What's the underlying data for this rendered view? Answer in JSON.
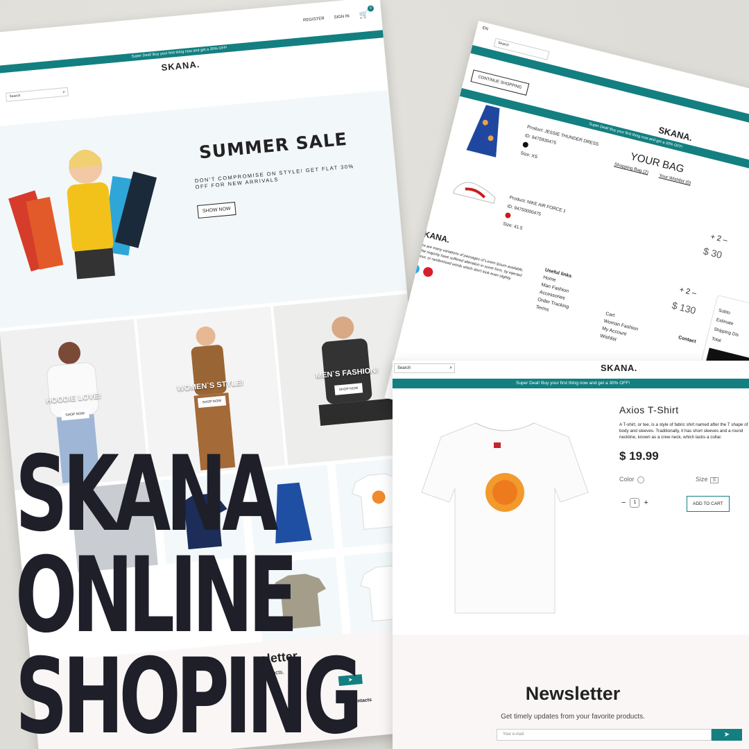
{
  "landing": {
    "nav": {
      "register": "REGISTER",
      "signin": "SIGN IN",
      "cart_count": "0"
    },
    "promo": "Super Deal! Buy your first thing now and get a 30% OFF!",
    "brand": "SKANA.",
    "search_placeholder": "Search",
    "hero": {
      "title": "SUMMER SALE",
      "subtitle": "DON'T COMPROMISE ON STYLE! GET FLAT 30% OFF FOR NEW ARRIVALS",
      "button": "SHOW NOW"
    },
    "categories": [
      {
        "label": "HOODIE LOVE!",
        "button": "SHOP NOW"
      },
      {
        "label": "WOMEN`S STYLE!",
        "button": "SHOP NOW"
      },
      {
        "label": "MEN`S FASHION!",
        "button": "SHOP NOW"
      }
    ],
    "newsletter": {
      "title": "sletter",
      "subtitle": "products."
    },
    "contacts": {
      "title": "Contacts"
    }
  },
  "cart_page": {
    "lang": "EN",
    "search_placeholder": "Search",
    "continue": "CONTINUE SHOPPING",
    "brand": "SKANA.",
    "promo": "Super Deal! Buy your first thing now and get a 30% OFF!",
    "bag_title": "YOUR BAG",
    "tabs": [
      "Shopping Bag (2)",
      "Your Wishlist (0)"
    ],
    "items": [
      {
        "product": "Product: JESSIE THUNDER DRESS",
        "id": "ID: 9475930475",
        "size": "Size: XS",
        "qty": "+ 2 –",
        "price": "$ 30",
        "dot": "#111111"
      },
      {
        "product": "Product: NIKE AIR FORCE 1",
        "id": "ID: 94750000475",
        "size": "Size: 41.5",
        "qty": "+ 2 –",
        "price": "$ 130",
        "dot": "#d01818"
      }
    ],
    "footer": {
      "brand": "SKANA.",
      "blurb": "There are many variations of passages of Lorem Ipsum available, but the majority have suffered alteration in some form, by injected humour, or randomised words which don't look even slightly",
      "links_title": "Useful links",
      "links_a": [
        "Home",
        "Man Fashion",
        "Accessories",
        "Order Tracking",
        "Terms"
      ],
      "links_b": [
        "Cart",
        "Woman Fashion",
        "My Account",
        "Wishlist"
      ],
      "contact": "Contact"
    },
    "summary": [
      "Subto",
      "Estimate",
      "Shipping Dis",
      "Total"
    ]
  },
  "product_page": {
    "search_placeholder": "Search",
    "brand": "SKANA.",
    "promo": "Super Deal! Buy your first thing now and get a 30% OFF!",
    "title": "Axios T-Shirt",
    "description": "A T-shirt, or tee, is a style of fabric shirt named after the T shape of its body and sleeves. Traditionally, it has short sleeves and a round neckline, known as a crew neck, which lacks a collar.",
    "price": "$ 19.99",
    "color_label": "Color",
    "size_label": "Size",
    "size_value": "S",
    "qty": "1",
    "add_to_cart": "ADD TO CART",
    "newsletter": {
      "title": "Newsletter",
      "subtitle": "Get timely updates from your favorite products.",
      "placeholder": "Your e-mail",
      "send": "➤"
    }
  },
  "headline": [
    "SKANA",
    "ONLINE",
    "SHOPING"
  ],
  "colors": {
    "accent": "#137f80",
    "headline": "#1f1f2a"
  }
}
